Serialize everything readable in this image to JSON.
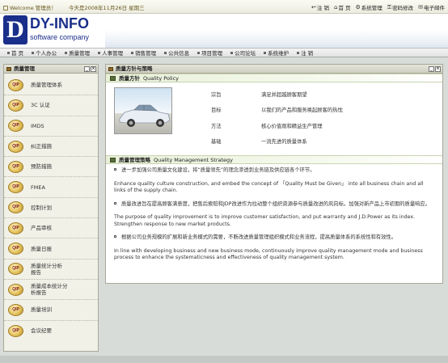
{
  "topbar": {
    "welcome": "Welcome 管理员！",
    "date": "今天是2008年11月26日  星期三",
    "links": [
      {
        "icon": "back",
        "label": "注 销"
      },
      {
        "icon": "home",
        "label": "首 页"
      },
      {
        "icon": "settings",
        "label": "系统管理"
      },
      {
        "icon": "key",
        "label": "密码修改"
      },
      {
        "icon": "mail",
        "label": "电子邮件"
      }
    ]
  },
  "logo": {
    "mark": "D",
    "brand": "DY-INFO",
    "sub": "software company"
  },
  "menu": [
    "首 页",
    "个人办公",
    "质量管理",
    "人事管理",
    "销售管理",
    "公共信息",
    "项目管理",
    "公司论坛",
    "系统维护",
    "注 销"
  ],
  "sidebar": {
    "title": "质量管理",
    "items": [
      {
        "badge": "QIP",
        "label": "质量管理体系"
      },
      {
        "badge": "QIP",
        "label": "3C 认证"
      },
      {
        "badge": "QIP",
        "label": "IMDS"
      },
      {
        "badge": "QIP",
        "label": "纠正措施"
      },
      {
        "badge": "QIP",
        "label": "预防措施"
      },
      {
        "badge": "QIP",
        "label": "FMEA"
      },
      {
        "badge": "QIP",
        "label": "控制计划"
      },
      {
        "badge": "QIP",
        "label": "产品审核"
      },
      {
        "badge": "QIP",
        "label": "质量日报"
      },
      {
        "badge": "QIP",
        "label": "质量统计分析报告"
      },
      {
        "badge": "QIP",
        "label": "质量成本统计分析报告"
      },
      {
        "badge": "QIP",
        "label": "质量培训"
      },
      {
        "badge": "QIP",
        "label": "会议纪要"
      }
    ]
  },
  "main": {
    "title": "质量方针与策略",
    "policy": {
      "heading": "质量方针",
      "heading_en": "Quality Policy",
      "rows": [
        {
          "k": "宗旨",
          "v": "满足并超越顾客期望"
        },
        {
          "k": "目标",
          "v": "以我们的产品和服务唤起顾客的热忱"
        },
        {
          "k": "方法",
          "v": "核心价值观和精益生产管理"
        },
        {
          "k": "基础",
          "v": "一流先进的质量体系"
        }
      ]
    },
    "strategy": {
      "heading": "质量管理策略",
      "heading_en": "Quality Management Strategy",
      "paras": [
        {
          "bullet": true,
          "text": "进一步加强公司质量文化建设，将“质量领先”的理念渗透到业务链及供应链各个环节。"
        },
        {
          "bullet": false,
          "text": "Enhance quality culture construction, and embed the concept of 「Quality Must be Given」 into all business chain and all links of the supply chain."
        },
        {
          "bullet": true,
          "text": "质量改进旨在提高顾客满意度，把售后索赔和JDP改进作为拉动整个组织资源参与质量改进的风向标。加强对新产品上市初期的质量响应。"
        },
        {
          "bullet": false,
          "text": "The purpose of quality improvement is to improve customer satisfaction, and put warranty and J.D.Power as its index. Strengthen response to new market products."
        },
        {
          "bullet": true,
          "text": "根据公司业务规模的扩展和新业务模式的需要，不断改进质量管理组织模式和业务流程，提高质量体系的系统性和有效性。"
        },
        {
          "bullet": false,
          "text": "In line with developing business and new business mode, continuously improve quality management mode and business process to enhance the systematicness and effectiveness of quality management system."
        }
      ]
    }
  }
}
